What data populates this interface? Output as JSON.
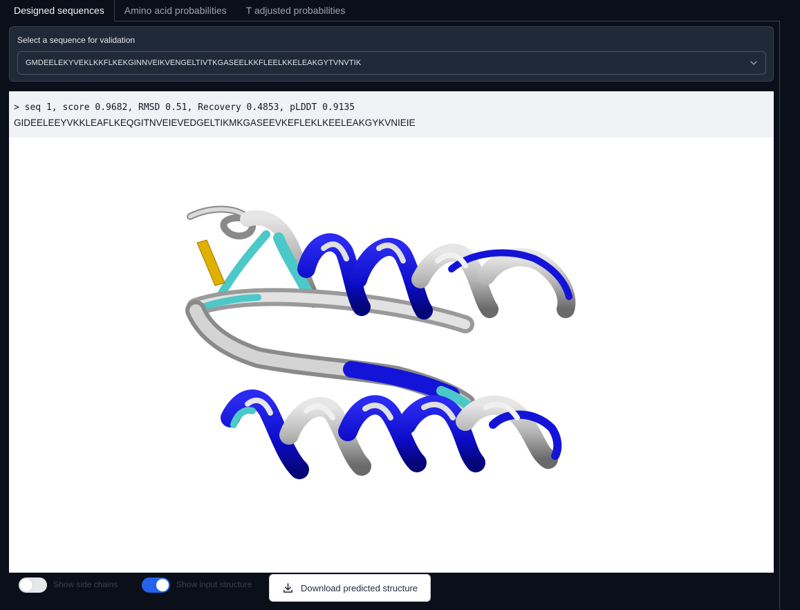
{
  "tabs": [
    {
      "label": "Designed sequences",
      "active": true
    },
    {
      "label": "Amino acid probabilities",
      "active": false
    },
    {
      "label": "T adjusted probabilities",
      "active": false
    }
  ],
  "select": {
    "label": "Select a sequence for validation",
    "value": "GMDEELEKYVEKLKKFLKEKGINNVEIKVENGELTIVTKGASEELKKFLEELKKELEAKGYTVNVTIK"
  },
  "sequence": {
    "header": "> seq 1, score 0.9682, RMSD 0.51, Recovery 0.4853, pLDDT 0.9135",
    "text": "GIDEELEEYVKKLEAFLKEQGITNVEIEVEDGELTIKMKGASEEVKEFLEKLKEELEAKGYKVNIEIE"
  },
  "controls": {
    "side_chains_label": "Show side chains",
    "side_chains_on": false,
    "input_structure_label": "Show input structure",
    "input_structure_on": true,
    "download_label": "Download predicted structure"
  },
  "colors": {
    "accent": "#2563eb",
    "structure_grey": "#c8c8c8",
    "structure_blue": "#1010d0",
    "structure_cyan": "#4cc8c8",
    "structure_yellow": "#e0b000"
  },
  "icons": {
    "select_chevron": "chevron-down-icon",
    "download": "download-icon"
  }
}
